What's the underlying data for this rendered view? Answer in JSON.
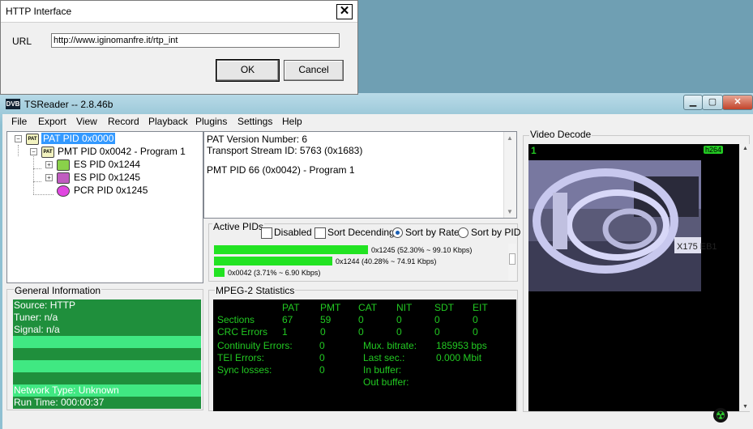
{
  "dialog": {
    "title": "HTTP Interface",
    "close_glyph": "✕",
    "url_label": "URL",
    "url_value": "http://www.iginomanfre.it/rtp_int",
    "ok_label": "OK",
    "cancel_label": "Cancel"
  },
  "window": {
    "icon_text": "DVB",
    "title": "TSReader -- 2.8.46b",
    "min_glyph": "▁",
    "max_glyph": "▢",
    "close_glyph": "✕"
  },
  "menu": [
    "File",
    "Export",
    "View",
    "Record",
    "Playback",
    "Plugins",
    "Settings",
    "Help"
  ],
  "tree": [
    {
      "label": "PAT PID 0x0000",
      "icon": "PAT",
      "icon_name": "pat-icon"
    },
    {
      "label": "PMT PID 0x0042 - Program 1",
      "icon": "PAT",
      "icon_name": "pmt-icon"
    },
    {
      "label": "ES PID 0x1244",
      "icon": "",
      "icon_name": "video-stream-icon"
    },
    {
      "label": "ES PID 0x1245",
      "icon": "",
      "icon_name": "audio-stream-icon"
    },
    {
      "label": "PCR PID 0x1245",
      "icon": "",
      "icon_name": "pcr-icon"
    }
  ],
  "info_lines": [
    "PAT Version Number: 6",
    "Transport Stream ID: 5763 (0x1683)",
    "",
    "PMT PID 66 (0x0042) - Program 1"
  ],
  "active_pids": {
    "title": "Active PIDs",
    "options": {
      "disabled": "Disabled",
      "sort_desc": "Sort Decending",
      "sort_rate": "Sort by Rate",
      "sort_pid": "Sort by PID"
    },
    "bars": [
      {
        "label": "0x1245 (52.30% ~ 99.10 Kbps)",
        "percent": 52.3
      },
      {
        "label": "0x1244 (40.28% ~ 74.91 Kbps)",
        "percent": 40.28
      },
      {
        "label": "0x0042 (3.71% ~ 6.90 Kbps)",
        "percent": 3.71
      }
    ]
  },
  "general_info": {
    "title": "General Information",
    "rows": [
      "Source: HTTP",
      "Tuner: n/a",
      "Signal: n/a",
      "",
      "",
      "",
      "",
      "Network Type: Unknown",
      "Run Time: 000:00:37"
    ]
  },
  "mpeg2": {
    "title": "MPEG-2 Statistics",
    "headers": [
      "PAT",
      "PMT",
      "CAT",
      "NIT",
      "SDT",
      "EIT"
    ],
    "sections_label": "Sections",
    "sections": [
      "67",
      "59",
      "0",
      "0",
      "0",
      "0"
    ],
    "crc_label": "CRC Errors",
    "crc": [
      "1",
      "0",
      "0",
      "0",
      "0",
      "0"
    ],
    "continuity_label": "Continuity Errors:",
    "continuity": "0",
    "tei_label": "TEI Errors:",
    "tei": "0",
    "sync_label": "Sync losses:",
    "sync": "0",
    "mux_label": "Mux. bitrate:",
    "mux": "185953 bps",
    "last_label": "Last sec.:",
    "last": "0.000 Mbit",
    "inbuf_label": "In buffer:",
    "outbuf_label": "Out buffer:"
  },
  "video": {
    "title": "Video Decode",
    "channel": "1",
    "codec": "h264",
    "sign_text": "X175 EB1"
  },
  "colors": {
    "selection": "#3399ff",
    "bar_green": "#22e322",
    "stat_green": "#22c922"
  }
}
